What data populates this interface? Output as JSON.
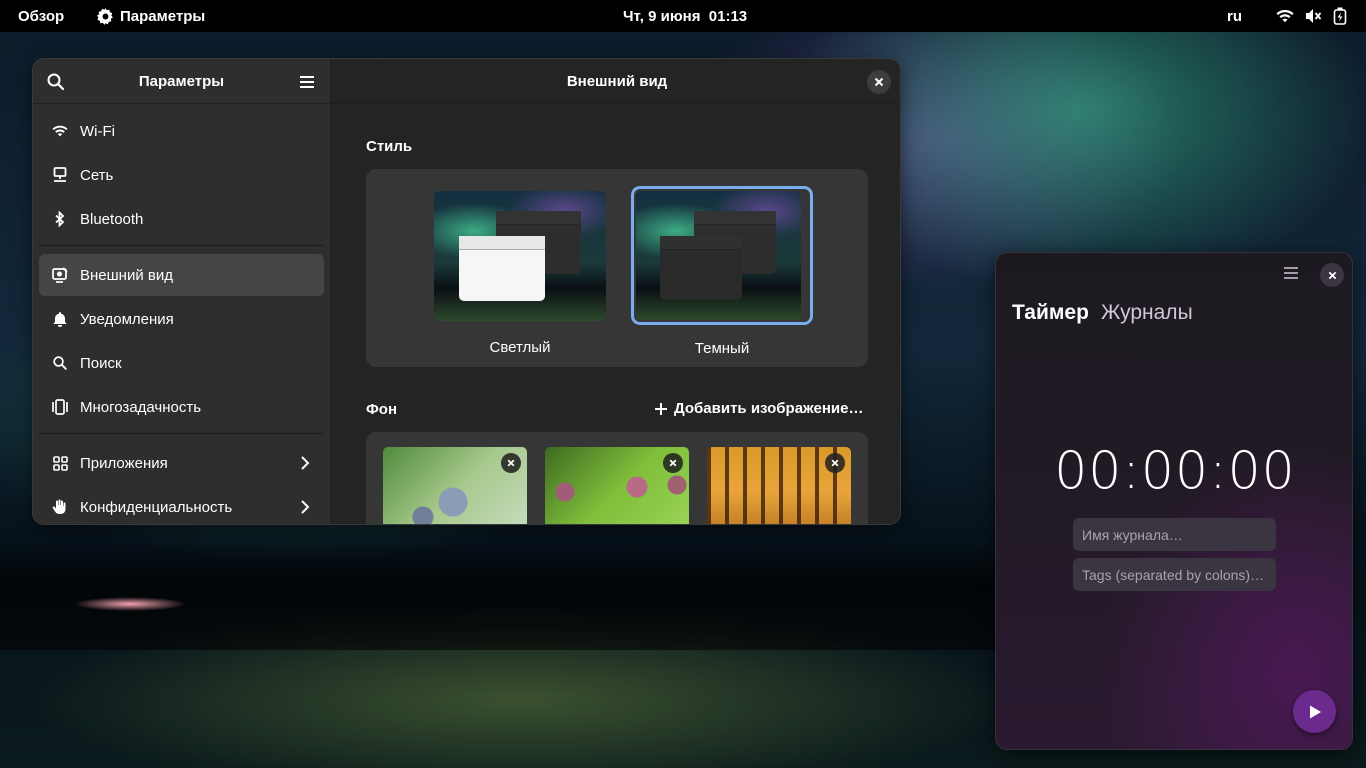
{
  "topbar": {
    "activities": "Обзор",
    "app_name": "Параметры",
    "clock": "Чт, 9 июня  01:13",
    "lang": "ru",
    "tray_icons": [
      "wifi-icon",
      "volume-muted-icon",
      "battery-charging-icon"
    ]
  },
  "settings": {
    "sidebar_title": "Параметры",
    "items": [
      {
        "label": "Wi-Fi",
        "icon": "wifi-icon"
      },
      {
        "label": "Сеть",
        "icon": "network-icon"
      },
      {
        "label": "Bluetooth",
        "icon": "bluetooth-icon"
      },
      {
        "label": "Внешний вид",
        "icon": "appearance-icon",
        "active": true
      },
      {
        "label": "Уведомления",
        "icon": "bell-icon"
      },
      {
        "label": "Поиск",
        "icon": "search-icon"
      },
      {
        "label": "Многозадачность",
        "icon": "multitasking-icon"
      },
      {
        "label": "Приложения",
        "icon": "apps-icon"
      },
      {
        "label": "Конфиденциальность",
        "icon": "hand-icon"
      }
    ],
    "page_title": "Внешний вид",
    "style_section": "Стиль",
    "style_options": [
      {
        "label": "Светлый",
        "selected": false
      },
      {
        "label": "Темный",
        "selected": true
      }
    ],
    "background_section": "Фон",
    "add_image": "Добавить изображение…",
    "accent_color": "#78aeed"
  },
  "timer": {
    "tab_active": "Таймер",
    "tab_other": "Журналы",
    "time": "00:00:00",
    "name_placeholder": "Имя журнала…",
    "tags_placeholder": "Tags (separated by colons)…",
    "play_color": "#6b2a8e"
  }
}
